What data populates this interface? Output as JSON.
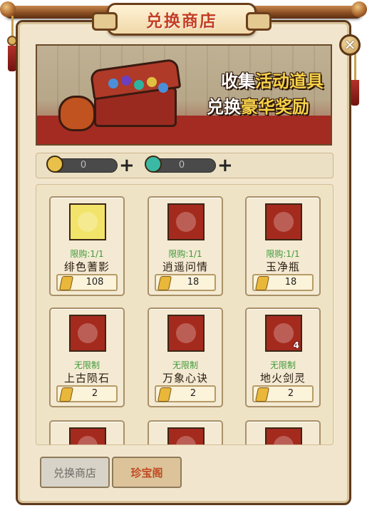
{
  "window": {
    "title": "兑换商店",
    "close_glyph": "✕"
  },
  "banner": {
    "line1_plain": "收集",
    "line1_highlight": "活动道具",
    "line2_plain": "兑换",
    "line2_highlight": "豪华奖励"
  },
  "currencies": [
    {
      "icon": "gold-leaf-coin-icon",
      "value": "0",
      "color": "#e9c049"
    },
    {
      "icon": "jade-ring-icon",
      "value": "0",
      "color": "#3bb9a5"
    }
  ],
  "items": [
    {
      "name": "绯色蓍影",
      "limit": "限购:1/1",
      "price": "108",
      "icon": "crimson-robe-icon",
      "bg": "#f2e36a",
      "badge": ""
    },
    {
      "name": "逍遥问情",
      "limit": "限购:1/1",
      "price": "18",
      "icon": "folded-cloth-icon",
      "bg": "#a52a1e",
      "badge": ""
    },
    {
      "name": "玉净瓶",
      "limit": "限购:1/1",
      "price": "18",
      "icon": "jade-vase-icon",
      "bg": "#a52a1e",
      "badge": ""
    },
    {
      "name": "上古陨石",
      "limit": "无限制",
      "price": "2",
      "icon": "meteorite-icon",
      "bg": "#a52a1e",
      "badge": ""
    },
    {
      "name": "万象心诀",
      "limit": "无限制",
      "price": "2",
      "icon": "scroll-talisman-icon",
      "bg": "#a52a1e",
      "badge": ""
    },
    {
      "name": "地火剑灵",
      "limit": "无限制",
      "price": "2",
      "icon": "flame-spirit-icon",
      "bg": "#a52a1e",
      "badge": "4"
    },
    {
      "name": "",
      "limit": "",
      "price": "",
      "icon": "partial-item-icon",
      "bg": "#a52a1e",
      "badge": ""
    },
    {
      "name": "",
      "limit": "",
      "price": "",
      "icon": "partial-item-icon",
      "bg": "#a52a1e",
      "badge": ""
    },
    {
      "name": "",
      "limit": "",
      "price": "",
      "icon": "partial-item-icon",
      "bg": "#a52a1e",
      "badge": ""
    }
  ],
  "tabs": [
    {
      "label": "兑换商店",
      "active": true
    },
    {
      "label": "珍宝阁",
      "active": false
    }
  ]
}
